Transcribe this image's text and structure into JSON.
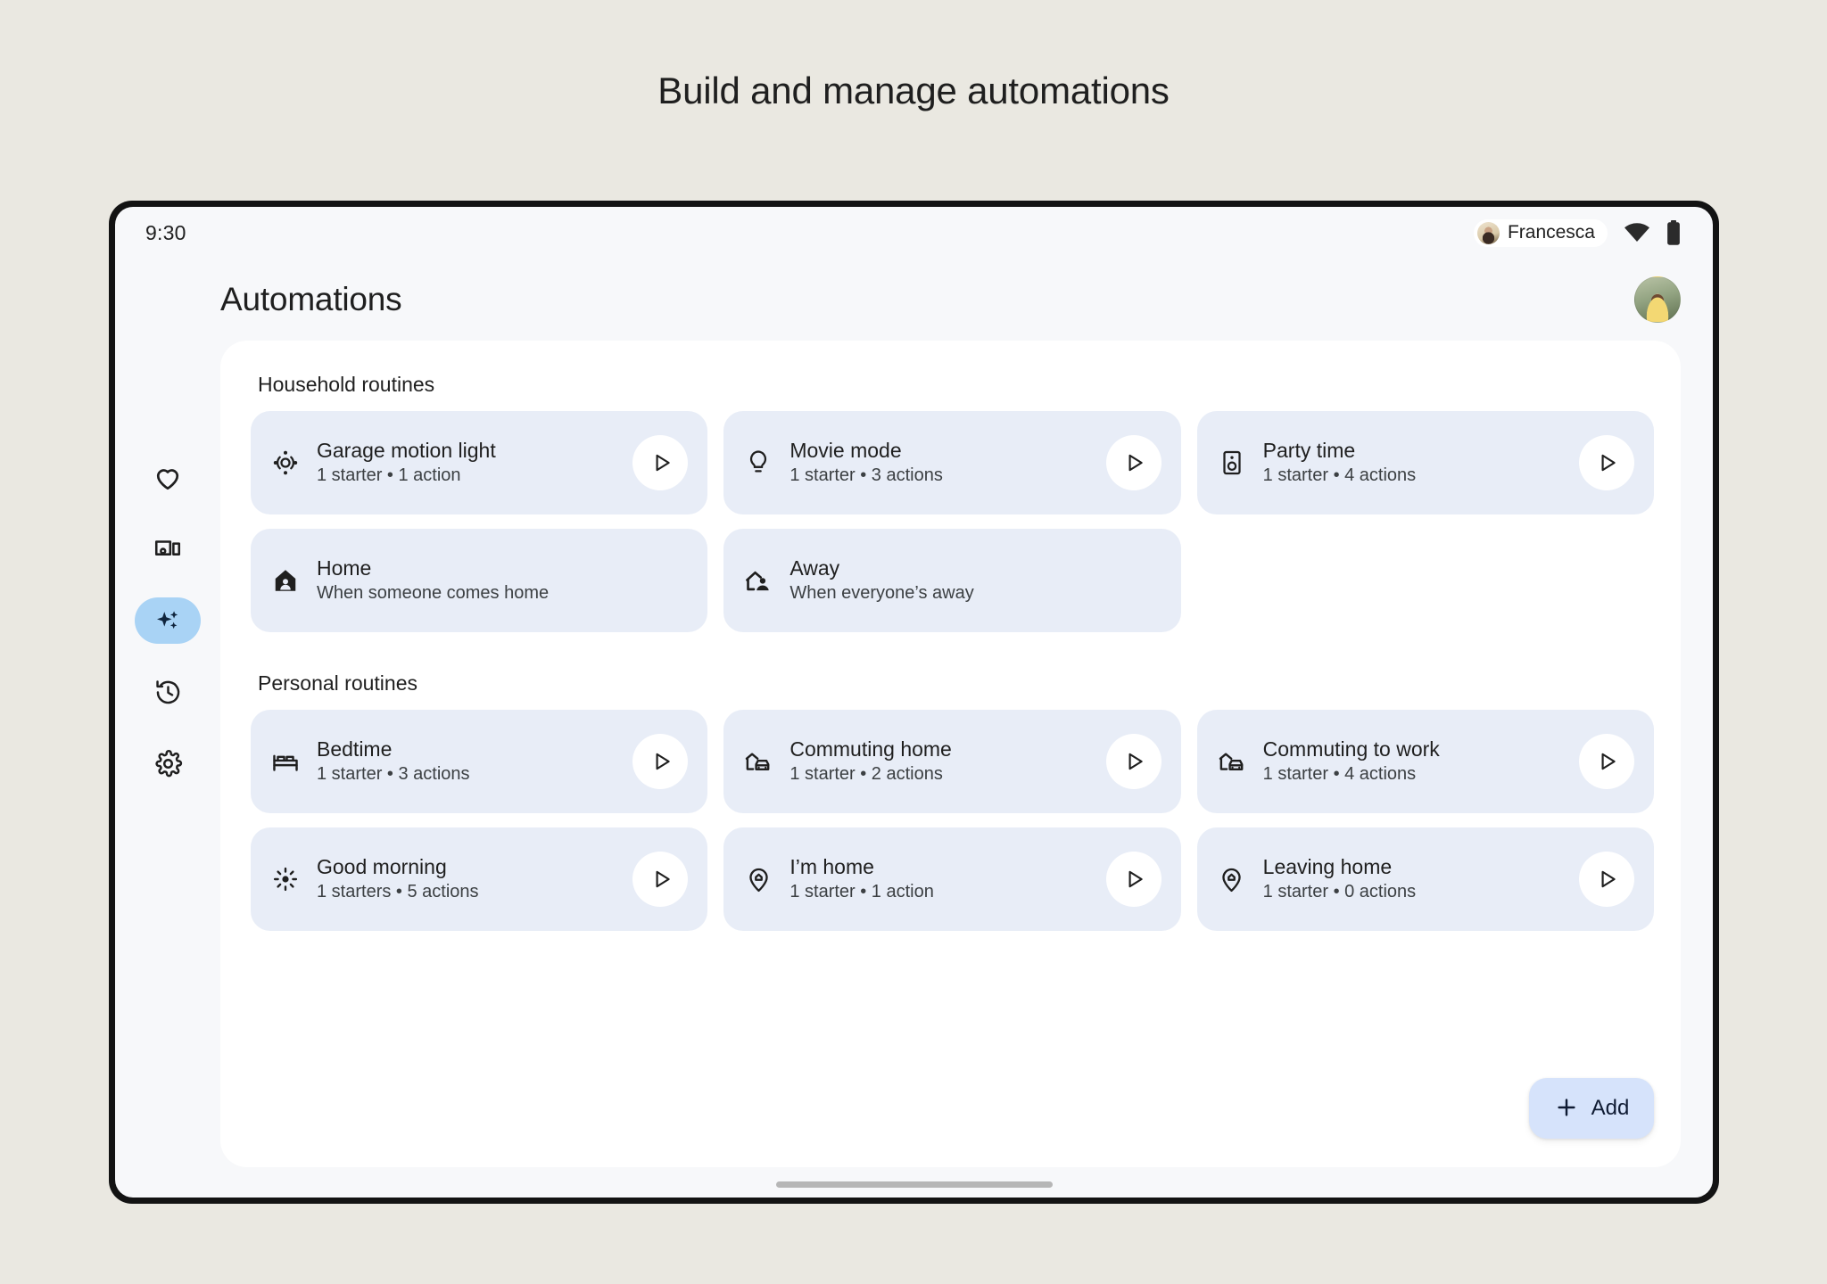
{
  "page": {
    "heading": "Build and manage automations",
    "background_color": "#eae8e1"
  },
  "status_bar": {
    "time": "9:30",
    "account_chip": {
      "name": "Francesca",
      "avatar_icon": "account-avatar"
    },
    "wifi_icon": "wifi-icon",
    "battery_icon": "battery-icon"
  },
  "app_bar": {
    "title": "Automations",
    "avatar_icon": "profile-avatar"
  },
  "nav_rail": {
    "items": [
      {
        "name": "favorites",
        "icon": "heart-icon",
        "active": false
      },
      {
        "name": "devices",
        "icon": "devices-icon",
        "active": false
      },
      {
        "name": "automations",
        "icon": "sparkles-icon",
        "active": true
      },
      {
        "name": "activity",
        "icon": "history-icon",
        "active": false
      },
      {
        "name": "settings",
        "icon": "gear-icon",
        "active": false
      }
    ],
    "active_pill_color": "#a9d3f5"
  },
  "sections": [
    {
      "title": "Household routines",
      "cards": [
        {
          "title": "Garage motion light",
          "subtitle": "1 starter • 1 action",
          "icon": "motion-sensor-icon",
          "has_play": true
        },
        {
          "title": "Movie mode",
          "subtitle": "1 starter • 3 actions",
          "icon": "lightbulb-icon",
          "has_play": true
        },
        {
          "title": "Party time",
          "subtitle": "1 starter • 4 actions",
          "icon": "speaker-icon",
          "has_play": true
        },
        {
          "title": "Home",
          "subtitle": "When someone comes home",
          "icon": "home-person-icon",
          "has_play": false
        },
        {
          "title": "Away",
          "subtitle": "When everyone’s away",
          "icon": "away-person-icon",
          "has_play": false
        }
      ]
    },
    {
      "title": "Personal routines",
      "cards": [
        {
          "title": "Bedtime",
          "subtitle": "1 starter • 3 actions",
          "icon": "bed-icon",
          "has_play": true
        },
        {
          "title": "Commuting home",
          "subtitle": "1 starter • 2 actions",
          "icon": "commute-icon",
          "has_play": true
        },
        {
          "title": "Commuting to work",
          "subtitle": "1 starter • 4 actions",
          "icon": "commute-icon",
          "has_play": true
        },
        {
          "title": "Good morning",
          "subtitle": "1 starters • 5 actions",
          "icon": "sun-icon",
          "has_play": true
        },
        {
          "title": "I’m home",
          "subtitle": "1 starter • 1 action",
          "icon": "home-pin-icon",
          "has_play": true
        },
        {
          "title": "Leaving home",
          "subtitle": "1 starter • 0 actions",
          "icon": "home-pin-icon",
          "has_play": true
        }
      ]
    }
  ],
  "add_button": {
    "label": "Add",
    "icon": "plus-icon",
    "color": "#d6e3fb"
  },
  "colors": {
    "card_surface": "#e8edf7",
    "content_surface": "#ffffff",
    "screen_background": "#f7f8fa",
    "text_primary": "#1f1f1f"
  }
}
